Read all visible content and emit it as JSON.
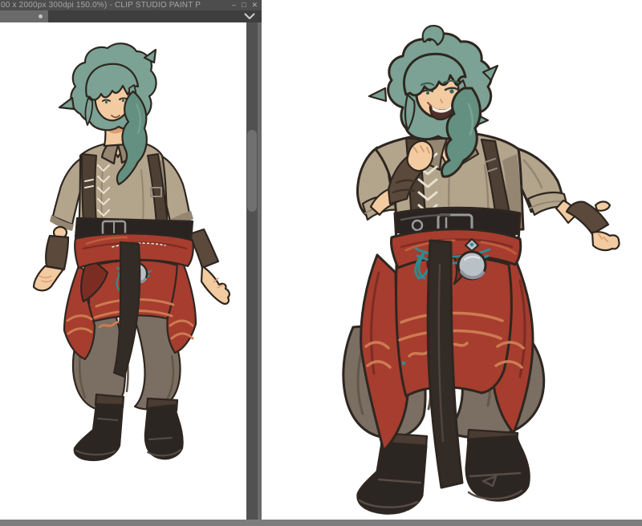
{
  "window": {
    "title": "00 x 2000px 300dpi 150.0%)  - CLIP STUDIO PAINT P",
    "controls": {
      "minimize": "–",
      "maximize": "□",
      "close": "✕"
    }
  },
  "colors": {
    "titlebar_bg": "#4d4d4d",
    "titlebar_text": "#a6a6a6",
    "tabbar_bg": "#3e3e3e",
    "tab_active_bg": "#6a6a6a",
    "tab_dot": "#c4c4c4",
    "chevron": "#cfcfcf",
    "scroll_track": "#515151",
    "scroll_thumb": "#707070",
    "window_border": "#6b6b6b",
    "statusbar_bg": "#7d7d7d",
    "canvas_bg": "#ffffff",
    "outline": "#2e2620",
    "hair": "#7ba294",
    "hair_shade": "#639080",
    "skin": "#f3cba1",
    "skin_shade": "#d99e74",
    "shirt": "#b3a48c",
    "shirt_shade": "#958672",
    "strap": "#4e4034",
    "lace": "#e9e1cf",
    "belt": "#292422",
    "buckle": "#9a9a9a",
    "sash": "#a63d2e",
    "sash_dark": "#7c2d23",
    "sash_light": "#cd7b52",
    "teal_cord": "#2e8b91",
    "medal": "#b9c0c6",
    "medal_shade": "#8d959c",
    "ribbon": "#332b26",
    "pants": "#7b6e62",
    "pants_shade": "#635749",
    "boots": "#2c2623",
    "boots_hi": "#584d45",
    "boots_cuff": "#4a3c33",
    "glove": "#5b4a3c",
    "glove_dark": "#3e3128"
  }
}
